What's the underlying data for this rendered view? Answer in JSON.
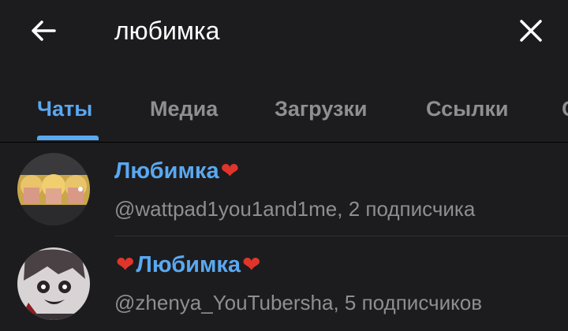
{
  "header": {
    "search_value": "любимка",
    "back_icon": "arrow-left-icon",
    "close_icon": "close-icon"
  },
  "tabs": [
    {
      "label": "Чаты",
      "active": true
    },
    {
      "label": "Медиа",
      "active": false
    },
    {
      "label": "Загрузки",
      "active": false
    },
    {
      "label": "Ссылки",
      "active": false
    }
  ],
  "results": [
    {
      "title": "Любимка",
      "title_suffix": "❤",
      "subtitle": "@wattpad1you1and1me, 2 подписчика",
      "avatar": "group-photo-avatar"
    },
    {
      "title_prefix": "❤",
      "title": "Любимка",
      "title_suffix": "❤",
      "subtitle": "@zhenya_YouTubersha, 5 подписчиков",
      "avatar": "anime-drawing-avatar"
    }
  ],
  "colors": {
    "background": "#1c1c1e",
    "accent": "#5aa8f0",
    "muted_text": "#8e8e93",
    "heart": "#e0352b"
  }
}
